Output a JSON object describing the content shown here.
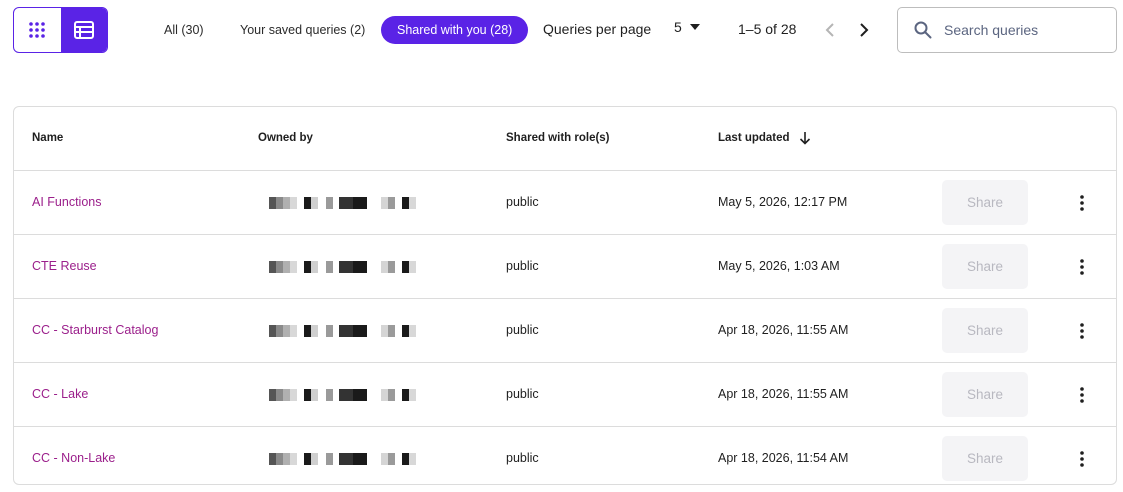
{
  "colors": {
    "accent": "#5a23e6",
    "link": "#9b1f8b",
    "share_disabled_bg": "#f4f4f6",
    "share_disabled_text": "#b8b8c0"
  },
  "toolbar": {
    "view_toggle": {
      "grid_icon": "grid-dots-icon",
      "list_icon": "table-list-icon",
      "active": "list"
    },
    "filters": [
      {
        "label": "All (30)",
        "active": false
      },
      {
        "label": "Your saved queries (2)",
        "active": false
      },
      {
        "label": "Shared with you (28)",
        "active": true
      }
    ],
    "queries_per_page_label": "Queries per page",
    "queries_per_page_value": "5",
    "pagination_text": "1–5 of 28",
    "search": {
      "placeholder": "Search queries",
      "value": ""
    }
  },
  "table": {
    "columns": {
      "name": "Name",
      "owned_by": "Owned by",
      "shared_with": "Shared with role(s)",
      "last_updated": "Last updated"
    },
    "share_label": "Share",
    "rows": [
      {
        "name": "AI Functions",
        "role": "public",
        "updated": "May 5, 2026, 12:17 PM"
      },
      {
        "name": "CTE Reuse",
        "role": "public",
        "updated": "May 5, 2026, 1:03 AM"
      },
      {
        "name": "CC - Starburst Catalog",
        "role": "public",
        "updated": "Apr 18, 2026, 11:55 AM"
      },
      {
        "name": "CC - Lake",
        "role": "public",
        "updated": "Apr 18, 2026, 11:55 AM"
      },
      {
        "name": "CC - Non-Lake",
        "role": "public",
        "updated": "Apr 18, 2026, 11:54 AM"
      }
    ]
  }
}
